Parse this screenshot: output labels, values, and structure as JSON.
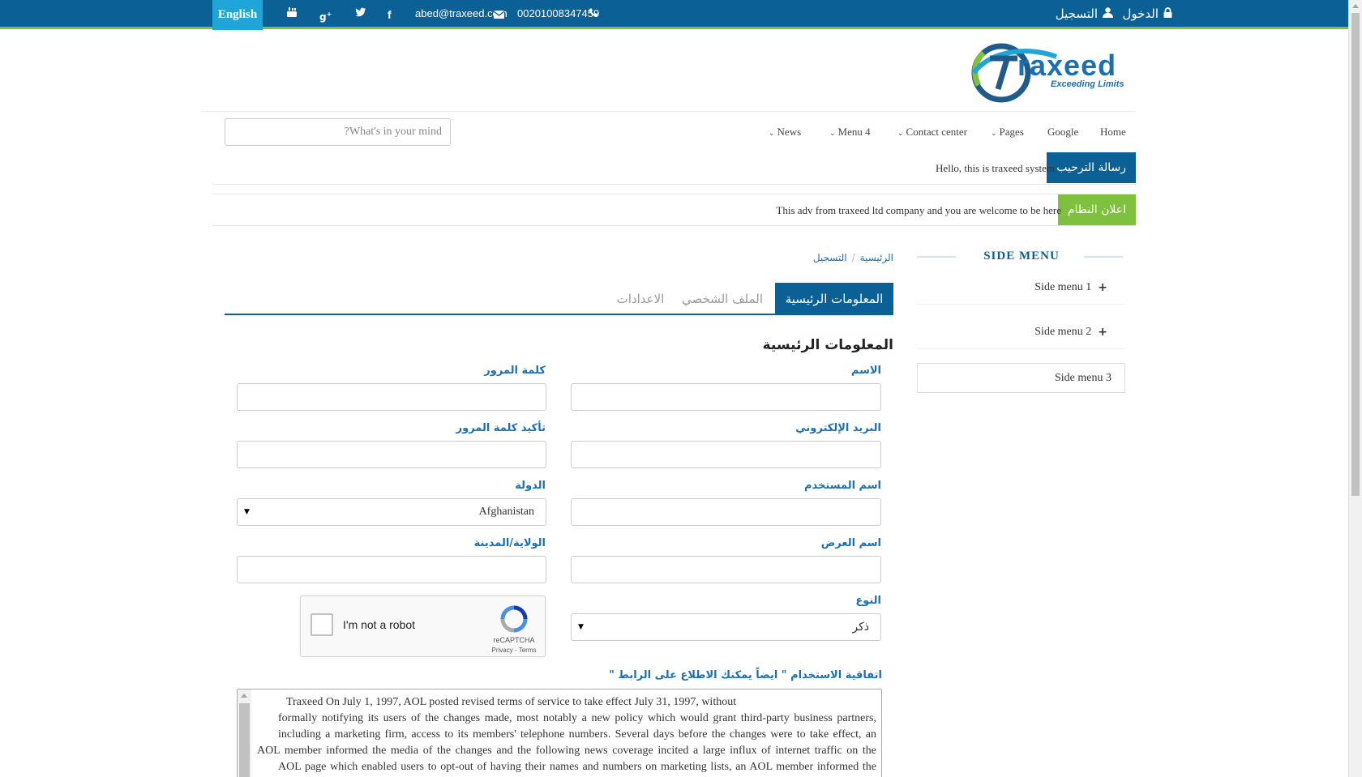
{
  "topbar": {
    "language_button": "English",
    "email": "abed@traxeed.com",
    "phone": "00201008347459",
    "login": "الدخول",
    "register": "التسجيل",
    "social_icons": [
      "youtube-icon",
      "google-plus-icon",
      "twitter-icon",
      "facebook-icon"
    ],
    "bg_color": "#0b6096",
    "accent_line_color": "#7ec13e"
  },
  "logo": {
    "text": "raxeed",
    "tagline": "Exceeding Limits"
  },
  "nav": {
    "items": [
      {
        "label": "Home",
        "dropdown": false
      },
      {
        "label": "Google",
        "dropdown": false
      },
      {
        "label": "Pages",
        "dropdown": true
      },
      {
        "label": "Contact center",
        "dropdown": true
      },
      {
        "label": "Menu 4",
        "dropdown": true
      },
      {
        "label": "News",
        "dropdown": true
      }
    ],
    "search_placeholder": "What's in your mind?"
  },
  "welcome": {
    "label": "رسالة الترحيب",
    "text": "Hello, this is traxeed system",
    "color": "#0b6096"
  },
  "announcement": {
    "label": "اعلان النظام",
    "text": "This adv from traxeed ltd company and you are welcome to be here",
    "color": "#7ec13e"
  },
  "side_menu": {
    "title": "SIDE MENU",
    "items": [
      {
        "label": "Side menu 1",
        "expandable": true
      },
      {
        "label": "Side menu 2",
        "expandable": true
      },
      {
        "label": "Side menu 3",
        "expandable": false
      }
    ]
  },
  "breadcrumb": {
    "home": "الرئيسية",
    "current": "التسجيل"
  },
  "tabs": [
    {
      "label": "المعلومات الرئيسية",
      "active": true
    },
    {
      "label": "الملف الشخصي",
      "active": false
    },
    {
      "label": "الاعدادات",
      "active": false
    }
  ],
  "form": {
    "section_title": "المعلومات الرئيسية",
    "name_label": "الاسم",
    "password_label": "كلمة المرور",
    "email_label": "البريد الإلكتروني",
    "confirm_password_label": "تأكيد كلمة المرور",
    "username_label": "اسم المستخدم",
    "country_label": "الدولة",
    "country_value": "Afghanistan",
    "display_name_label": "اسم العرض",
    "state_city_label": "الولاية/المدينة",
    "gender_label": "النوع",
    "gender_value": "ذكر",
    "captcha_label": "I'm not a robot",
    "captcha_brand": "reCAPTCHA",
    "captcha_links": "Privacy - Terms",
    "terms_label": "اتفاقية الاستخدام \" ايضاً يمكنك الاطلاع على الرابط \"",
    "terms_lines": [
      "Traxeed On July 1, 1997, AOL posted revised terms of service to take effect July 31, 1997, without",
      "formally notifying its users of the changes made, most notably a new policy which would grant third-party business partners,",
      "including a marketing firm, access to its members' telephone numbers. Several days before the changes were to take effect, an",
      "AOL member informed the media of the changes and the following news coverage incited a large influx of internet traffic on the",
      "AOL page which enabled users to opt-out of having their names and numbers on marketing lists, an AOL member informed the"
    ]
  }
}
